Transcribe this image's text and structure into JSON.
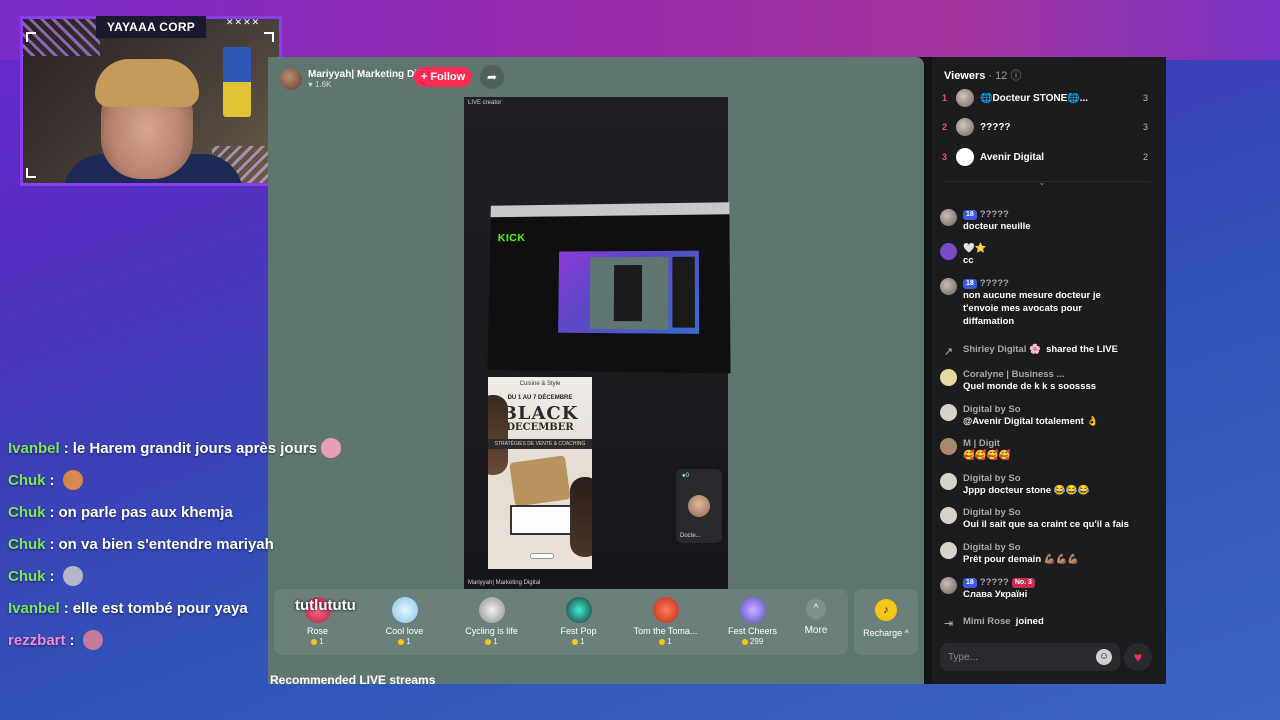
{
  "webcam": {
    "title": "YAYAAA CORP"
  },
  "host": {
    "name": "Mariyyah| Marketing Di...",
    "likes": "1.6K",
    "follow_label": "+ Follow",
    "share_icon": "share-arrow-icon"
  },
  "phone": {
    "top_label": "LIVE creator",
    "bottom_label": "Mariyyah| Marketing Digital",
    "kick": "KICK",
    "flyer": {
      "header": "Cuisine & Style",
      "date": "DU 1 AU 7 DÉCEMBRE",
      "title1": "BLACK",
      "title2": "DECEMBER",
      "band": "STRATÉGIES DE VENTE & COACHING"
    },
    "guest_label": "Docte..."
  },
  "overlay_text": "tutlututu",
  "gifts": [
    {
      "name": "Rose",
      "price": "1",
      "color": "#d63b5a"
    },
    {
      "name": "Cool love",
      "price": "1",
      "color": "#a9d9f5"
    },
    {
      "name": "Cycling is life",
      "price": "1",
      "color": "#d9d9d9"
    },
    {
      "name": "Fest Pop",
      "price": "1",
      "color": "#27c4a6"
    },
    {
      "name": "Tom the Toma...",
      "price": "1",
      "color": "#e0492f"
    },
    {
      "name": "Fest Cheers",
      "price": "299",
      "color": "#7c6ae0"
    }
  ],
  "more_label": "More",
  "recharge_label": "Recharge ^",
  "recommended_label": "Recommended LIVE streams",
  "viewers": {
    "title": "Viewers",
    "count": "· 12",
    "list": [
      {
        "rank": "1",
        "name": "🌐Docteur STONE🌐...",
        "count": "3"
      },
      {
        "rank": "2",
        "name": "?????",
        "count": "3"
      },
      {
        "rank": "3",
        "name": "Avenir Digital",
        "count": "2"
      }
    ]
  },
  "chat": [
    {
      "user": "?????",
      "badge": "18",
      "text": "docteur neuille"
    },
    {
      "user": "🤍⭐",
      "badge": "",
      "text": "cc"
    },
    {
      "user": "?????",
      "badge": "18",
      "text": "non aucune mesure docteur je t'envoie mes avocats pour diffamation"
    },
    {
      "event": "share",
      "user": "Shirley Digital 🌸",
      "text": "shared the LIVE"
    },
    {
      "user": "Coralyne | Business ...",
      "badge": "",
      "text": "Quel monde de k k s soossss"
    },
    {
      "user": "Digital by So",
      "badge": "",
      "text": "@Avenir Digital totalement 👌"
    },
    {
      "user": "M | Digit",
      "badge": "",
      "text": "🥰🥰🥰🥰"
    },
    {
      "user": "Digital by So",
      "badge": "",
      "text": "Jppp docteur stone 😂😂😂"
    },
    {
      "user": "Digital by So",
      "badge": "",
      "text": "Oui il sait que sa craint ce qu'il a fais"
    },
    {
      "user": "Digital by So",
      "badge": "",
      "text": "Prêt pour demain 💪🏽💪🏽💪🏽"
    },
    {
      "user": "?????",
      "badge": "18",
      "badge2": "No. 3",
      "text": "Слава Україні"
    },
    {
      "event": "join",
      "user": "Mimi Rose",
      "text": "joined"
    }
  ],
  "chat_input": {
    "placeholder": "Type..."
  },
  "overlay_chat": [
    {
      "user": "Ivanbel",
      "color": "green",
      "text": "le Harem grandit jours après jours",
      "emote": "#e8a0b8"
    },
    {
      "user": "Chuk",
      "color": "green",
      "text": "",
      "emote": "#d9874a"
    },
    {
      "user": "Chuk",
      "color": "green",
      "text": "on parle pas aux khemja",
      "emote": ""
    },
    {
      "user": "Chuk",
      "color": "green",
      "text": "on va bien s'entendre mariyah",
      "emote": ""
    },
    {
      "user": "Chuk",
      "color": "green",
      "text": "",
      "emote": "#b6b6c8"
    },
    {
      "user": "Ivanbel",
      "color": "green",
      "text": "elle est tombé pour yaya",
      "emote": ""
    },
    {
      "user": "rezzbart",
      "color": "pink",
      "text": "",
      "emote": "#c77b9a"
    }
  ]
}
